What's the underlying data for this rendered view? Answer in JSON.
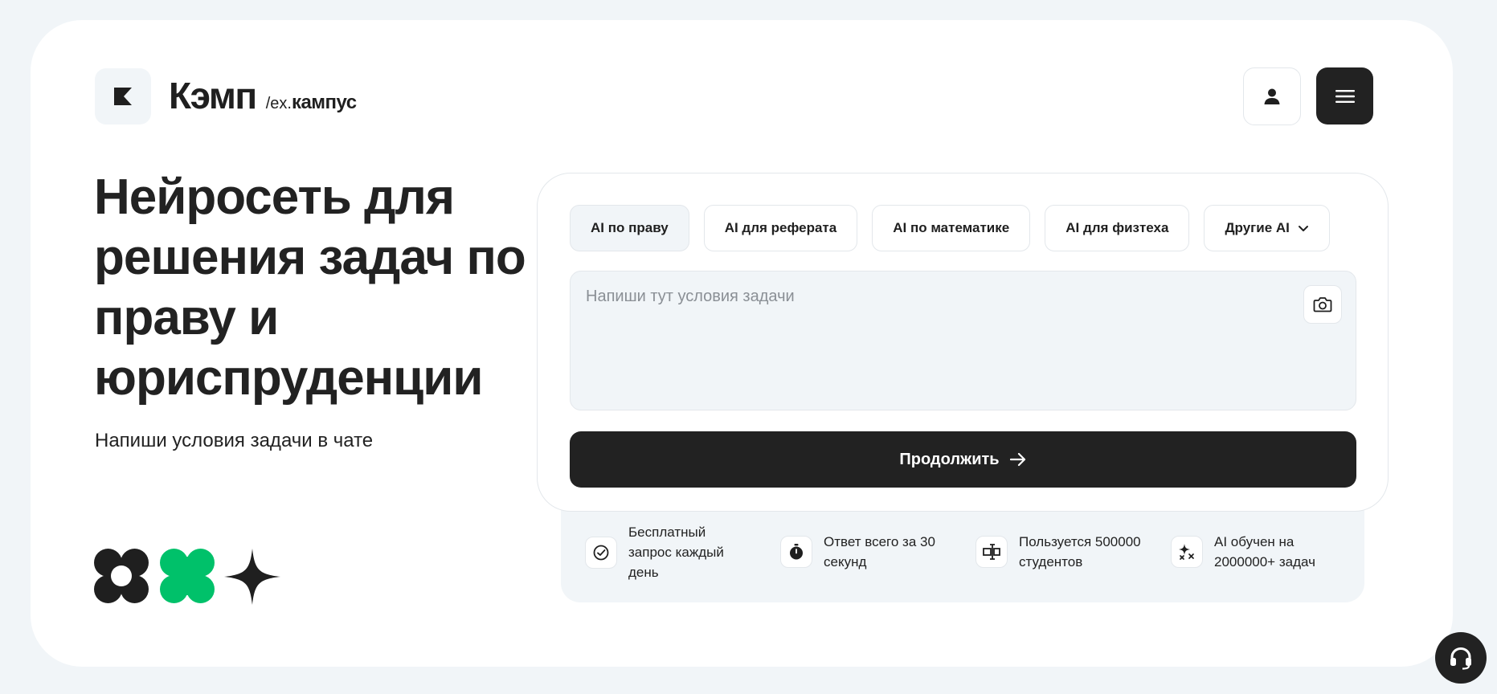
{
  "header": {
    "brand_name": "Кэмп",
    "brand_ex": "/ex.",
    "brand_old": "кампус",
    "logo_icon": "k-logo-icon",
    "user_icon": "user-icon",
    "menu_icon": "hamburger-menu-icon"
  },
  "hero": {
    "title": "Нейросеть для решения задач по праву и юриспруденции",
    "subtitle": "Напиши условия задачи в чате"
  },
  "tabs": [
    {
      "label": "AI по праву",
      "active": true
    },
    {
      "label": "AI для реферата",
      "active": false
    },
    {
      "label": "AI по математике",
      "active": false
    },
    {
      "label": "AI для физтеха",
      "active": false
    },
    {
      "label": "Другие AI",
      "active": false,
      "dropdown": true
    }
  ],
  "form": {
    "placeholder": "Напиши тут условия задачи",
    "camera_icon": "camera-icon",
    "submit_label": "Продолжить",
    "submit_icon": "arrow-right-icon"
  },
  "features": [
    {
      "icon": "check-circle-icon",
      "text": "Бесплатный запрос каждый день"
    },
    {
      "icon": "stopwatch-icon",
      "text": "Ответ всего за 30 секунд"
    },
    {
      "icon": "students-icon",
      "text": "Пользуется 500000 студентов"
    },
    {
      "icon": "sparkles-icon",
      "text": "AI обучен на 2000000+ задач"
    }
  ],
  "support_icon": "headset-icon",
  "colors": {
    "background": "#f1f5f8",
    "dark": "#222222",
    "accent_green": "#00c16a"
  }
}
